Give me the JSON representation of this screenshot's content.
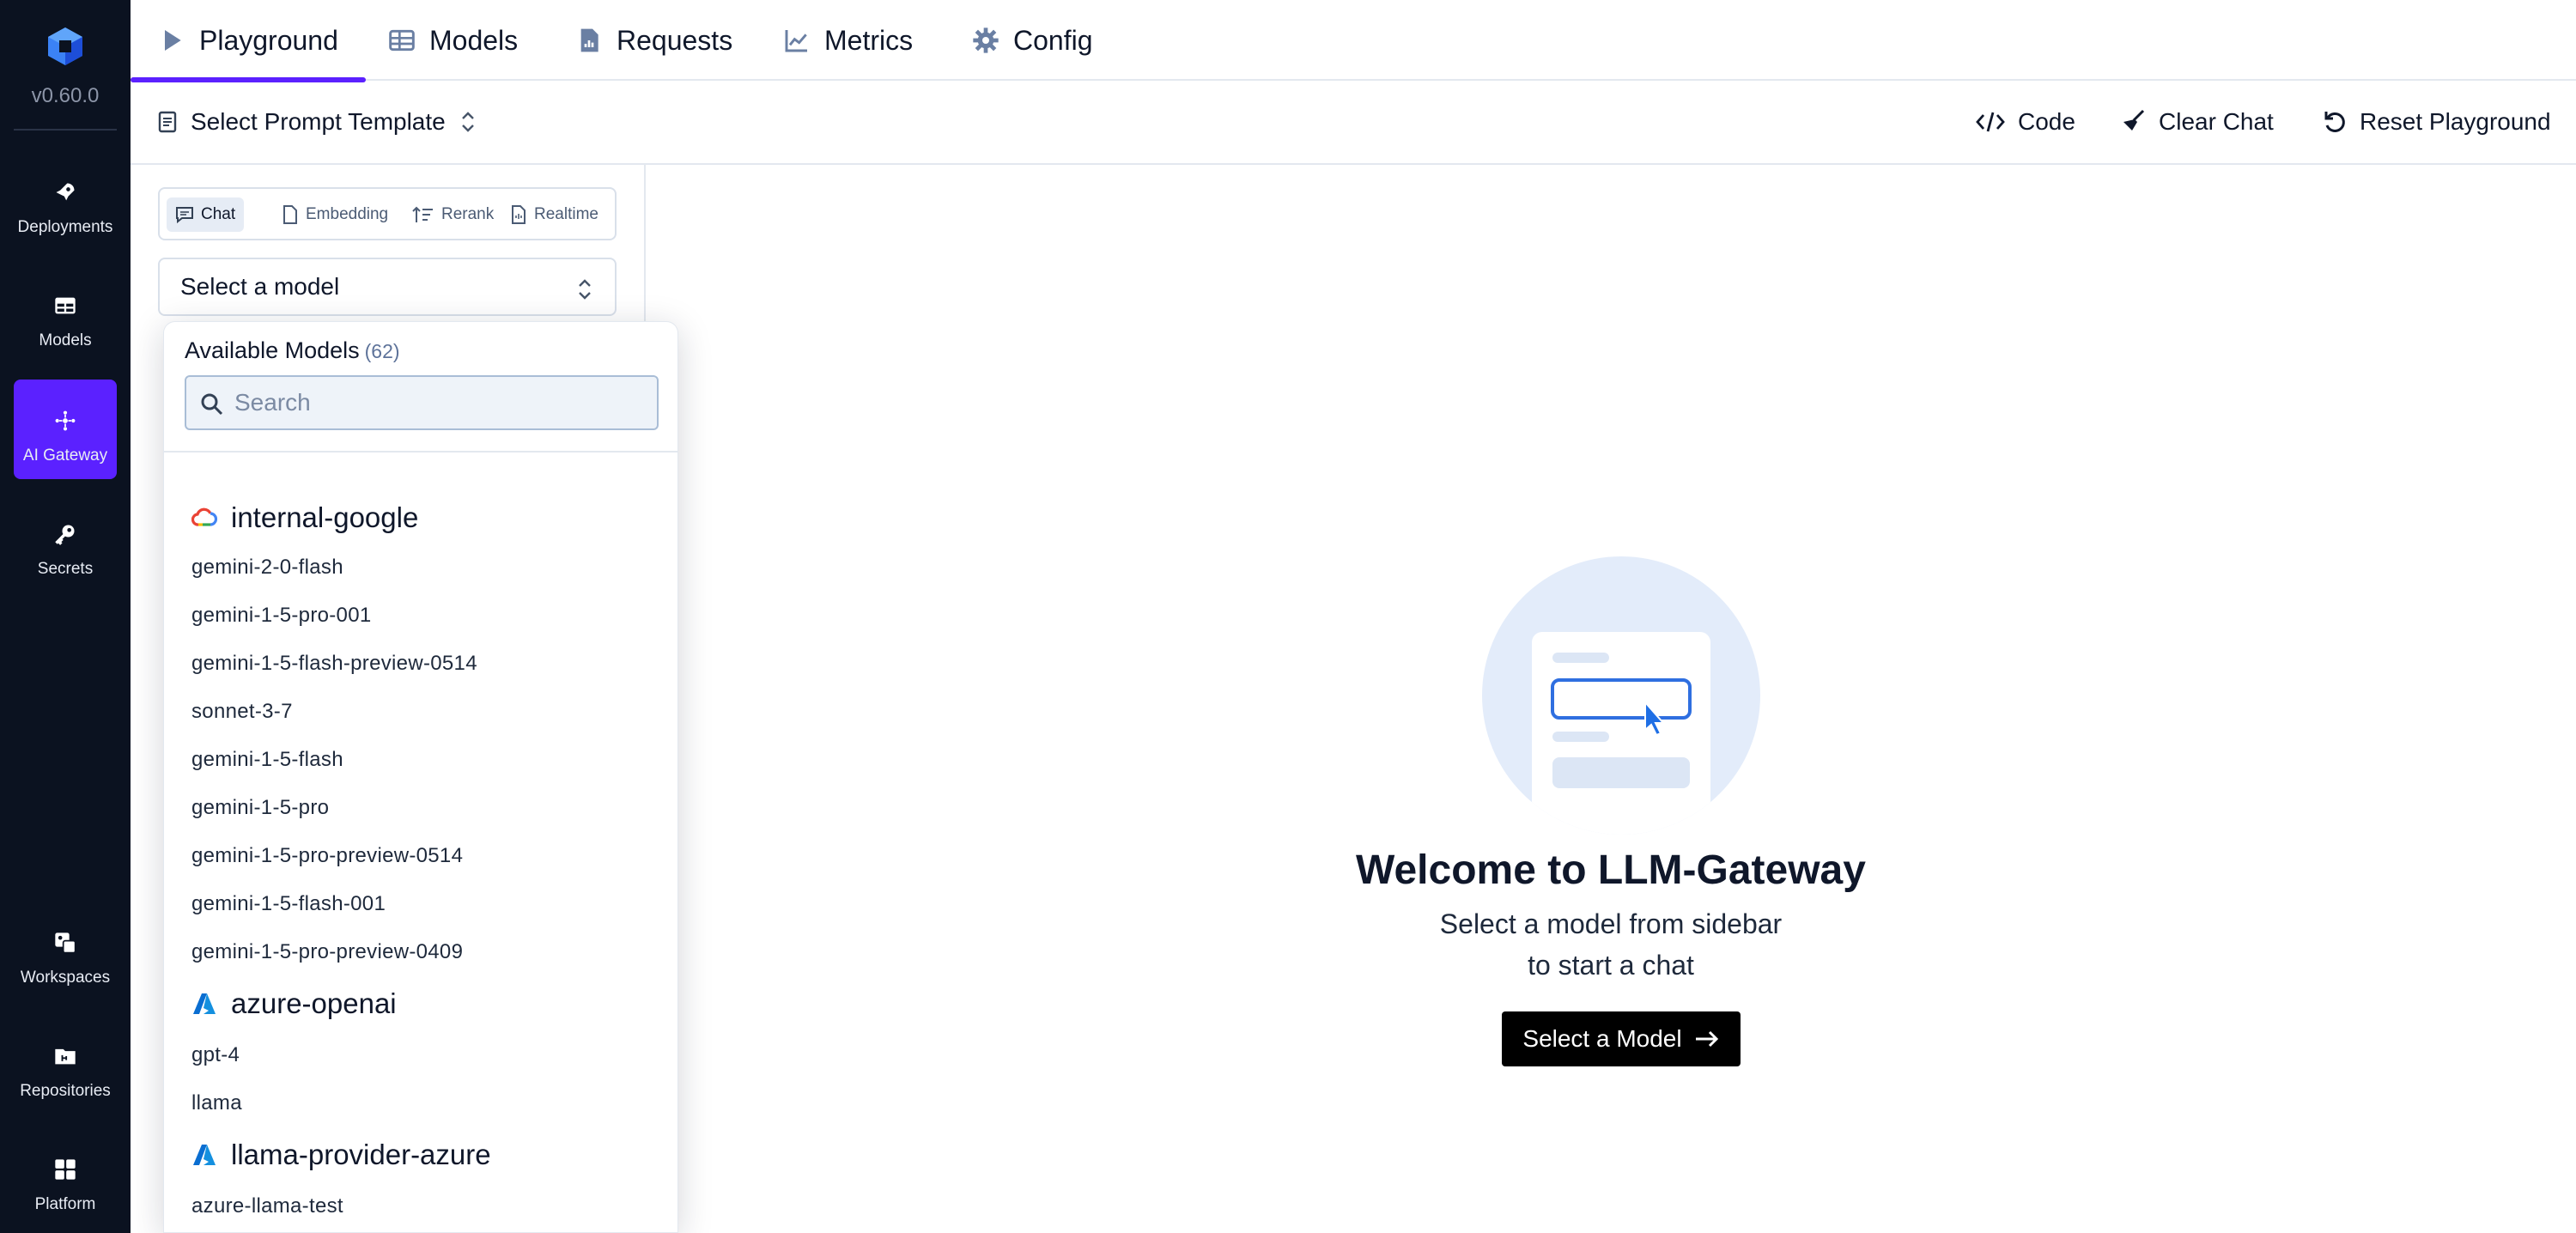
{
  "app": {
    "version": "v0.60.0"
  },
  "sidebar": {
    "items": [
      {
        "label": "Deployments",
        "icon": "rocket-icon"
      },
      {
        "label": "Models",
        "icon": "grid-icon"
      },
      {
        "label": "AI Gateway",
        "icon": "gateway-icon",
        "active": true
      },
      {
        "label": "Secrets",
        "icon": "key-icon"
      },
      {
        "label": "Workspaces",
        "icon": "workspaces-icon"
      },
      {
        "label": "Repositories",
        "icon": "folder-icon"
      },
      {
        "label": "Platform",
        "icon": "platform-icon"
      }
    ]
  },
  "topnav": {
    "tabs": [
      {
        "label": "Playground",
        "icon": "play-icon",
        "active": true
      },
      {
        "label": "Models",
        "icon": "table-icon"
      },
      {
        "label": "Requests",
        "icon": "document-chart-icon"
      },
      {
        "label": "Metrics",
        "icon": "line-chart-icon"
      },
      {
        "label": "Config",
        "icon": "gear-icon"
      }
    ]
  },
  "toolbar": {
    "prompt_template": "Select Prompt Template",
    "code": "Code",
    "clear_chat": "Clear Chat",
    "reset": "Reset Playground"
  },
  "panel": {
    "modes": [
      "Chat",
      "Embedding",
      "Rerank",
      "Realtime"
    ],
    "active_mode": "Chat",
    "model_select": "Select a model"
  },
  "dropdown": {
    "title": "Available Models",
    "count": "(62)",
    "search_placeholder": "Search",
    "groups": [
      {
        "name": "internal-google",
        "icon": "google-cloud-icon",
        "models": [
          "gemini-2-0-flash",
          "gemini-1-5-pro-001",
          "gemini-1-5-flash-preview-0514",
          "sonnet-3-7",
          "gemini-1-5-flash",
          "gemini-1-5-pro",
          "gemini-1-5-pro-preview-0514",
          "gemini-1-5-flash-001",
          "gemini-1-5-pro-preview-0409"
        ]
      },
      {
        "name": "azure-openai",
        "icon": "azure-icon",
        "models": [
          "gpt-4",
          "llama"
        ]
      },
      {
        "name": "llama-provider-azure",
        "icon": "azure-icon",
        "models": [
          "azure-llama-test"
        ]
      }
    ]
  },
  "welcome": {
    "title": "Welcome to LLM-Gateway",
    "line1": "Select a model from sidebar",
    "line2": "to start a chat",
    "button": "Select a Model"
  },
  "colors": {
    "accent": "#5b21ff",
    "sidebar_bg": "#0b1220",
    "azure_blue": "#0a6ed1"
  }
}
